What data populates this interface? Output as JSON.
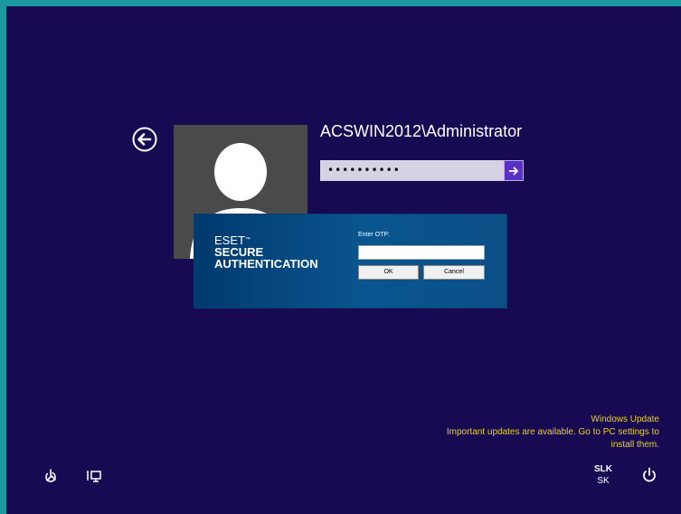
{
  "login": {
    "username": "ACSWIN2012\\Administrator",
    "password_mask": "••••••••••",
    "submit_arrow": "→"
  },
  "eset_dialog": {
    "brand_line1": "ESET",
    "brand_tm": "™",
    "brand_line2": "SECURE",
    "brand_line3": "AUTHENTICATION",
    "otp_label": "Enter OTP:",
    "otp_value": "",
    "ok_label": "OK",
    "cancel_label": "Cancel"
  },
  "windows_update": {
    "title": "Windows Update",
    "line1": "Important updates are available. Go to PC settings to",
    "line2": "install them."
  },
  "language": {
    "code": "SLK",
    "sub": "SK"
  },
  "icons": {
    "back": "back-arrow-circle-icon",
    "ease_of_access": "ease-of-access-icon",
    "network": "network-icon",
    "power": "power-icon"
  },
  "colors": {
    "background": "#180a52",
    "accent": "#5a2fc8",
    "update_text": "#e8d020",
    "eset_blue": "#0a5590"
  }
}
